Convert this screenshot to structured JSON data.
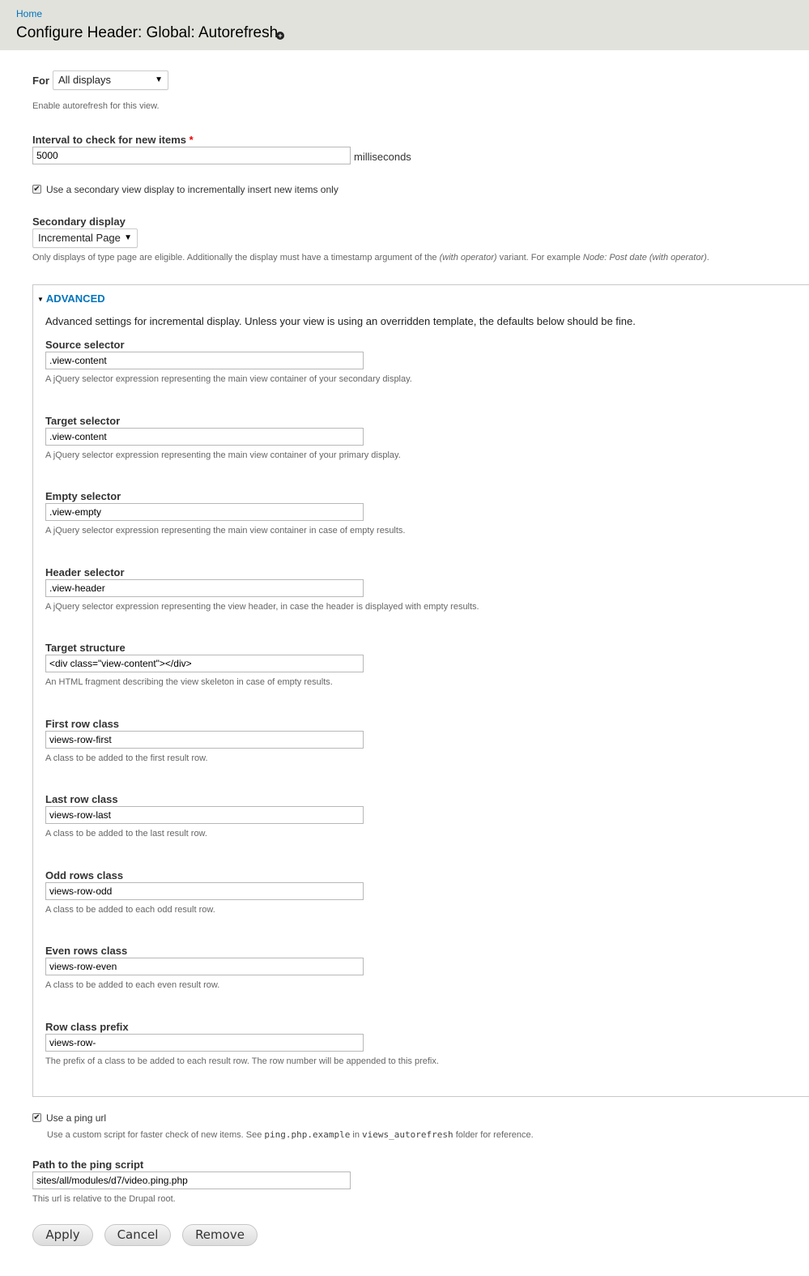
{
  "header": {
    "breadcrumb": "Home",
    "title": "Configure Header: Global: Autorefresh",
    "shortcut_icon": "plus-circle-icon"
  },
  "for_field": {
    "label": "For",
    "value": "All displays"
  },
  "enable_text": "Enable autorefresh for this view.",
  "interval": {
    "label": "Interval to check for new items",
    "required_marker": "*",
    "value": "5000",
    "suffix": "milliseconds"
  },
  "secondary_checkbox": {
    "label": "Use a secondary view display to incrementally insert new items only",
    "checked": true
  },
  "secondary_display": {
    "label": "Secondary display",
    "value": "Incremental Page",
    "desc_1": "Only displays of type page are eligible. Additionally the display must have a timestamp argument of the ",
    "desc_em1": "(with operator)",
    "desc_2": " variant. For example ",
    "desc_em2": "Node: Post date (with operator)",
    "desc_3": "."
  },
  "advanced": {
    "legend": "ADVANCED",
    "intro": "Advanced settings for incremental display. Unless your view is using an overridden template, the defaults below should be fine.",
    "fields": [
      {
        "label": "Source selector",
        "value": ".view-content",
        "desc": "A jQuery selector expression representing the main view container of your secondary display."
      },
      {
        "label": "Target selector",
        "value": ".view-content",
        "desc": "A jQuery selector expression representing the main view container of your primary display."
      },
      {
        "label": "Empty selector",
        "value": ".view-empty",
        "desc": "A jQuery selector expression representing the main view container in case of empty results."
      },
      {
        "label": "Header selector",
        "value": ".view-header",
        "desc": "A jQuery selector expression representing the view header, in case the header is displayed with empty results."
      },
      {
        "label": "Target structure",
        "value": "<div class=\"view-content\"></div>",
        "desc": "An HTML fragment describing the view skeleton in case of empty results."
      },
      {
        "label": "First row class",
        "value": "views-row-first",
        "desc": "A class to be added to the first result row."
      },
      {
        "label": "Last row class",
        "value": "views-row-last",
        "desc": "A class to be added to the last result row."
      },
      {
        "label": "Odd rows class",
        "value": "views-row-odd",
        "desc": "A class to be added to each odd result row."
      },
      {
        "label": "Even rows class",
        "value": "views-row-even",
        "desc": "A class to be added to each even result row."
      },
      {
        "label": "Row class prefix",
        "value": "views-row-",
        "desc": "The prefix of a class to be added to each result row. The row number will be appended to this prefix."
      }
    ]
  },
  "ping": {
    "checkbox_label": "Use a ping url",
    "checked": true,
    "desc_1": "Use a custom script for faster check of new items. See ",
    "code_1": "ping.php.example",
    "desc_2": " in ",
    "code_2": "views_autorefresh",
    "desc_3": " folder for reference."
  },
  "ping_path": {
    "label": "Path to the ping script",
    "value": "sites/all/modules/d7/video.ping.php",
    "desc": "This url is relative to the Drupal root."
  },
  "buttons": {
    "apply": "Apply",
    "cancel": "Cancel",
    "remove": "Remove"
  }
}
